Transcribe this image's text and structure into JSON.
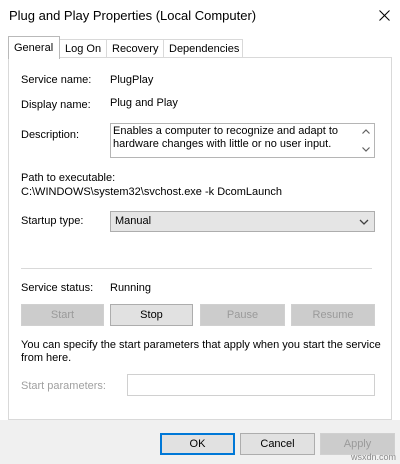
{
  "window": {
    "title": "Plug and Play Properties (Local Computer)"
  },
  "tabs": [
    {
      "label": "General",
      "active": true
    },
    {
      "label": "Log On",
      "active": false
    },
    {
      "label": "Recovery",
      "active": false
    },
    {
      "label": "Dependencies",
      "active": false
    }
  ],
  "general": {
    "service_name_label": "Service name:",
    "service_name": "PlugPlay",
    "display_name_label": "Display name:",
    "display_name": "Plug and Play",
    "description_label": "Description:",
    "description": "Enables a computer to recognize and adapt to hardware changes with little or no user input.",
    "path_label": "Path to executable:",
    "path": "C:\\WINDOWS\\system32\\svchost.exe -k DcomLaunch",
    "startup_type_label": "Startup type:",
    "startup_type": "Manual",
    "service_status_label": "Service status:",
    "service_status": "Running",
    "buttons": {
      "start": "Start",
      "stop": "Stop",
      "pause": "Pause",
      "resume": "Resume"
    },
    "help_text": "You can specify the start parameters that apply when you start the service from here.",
    "start_params_label": "Start parameters:",
    "start_params_value": ""
  },
  "footer": {
    "ok": "OK",
    "cancel": "Cancel",
    "apply": "Apply"
  },
  "watermark": "wsxdn.com",
  "icons": {
    "close": "close-icon",
    "scroll_up": "arrow-up-icon",
    "scroll_down": "arrow-down-icon",
    "dropdown": "chevron-down-icon"
  },
  "colors": {
    "focus_border": "#0078d7",
    "disabled_text": "#a0a0a0",
    "button_face": "#e1e1e1"
  }
}
